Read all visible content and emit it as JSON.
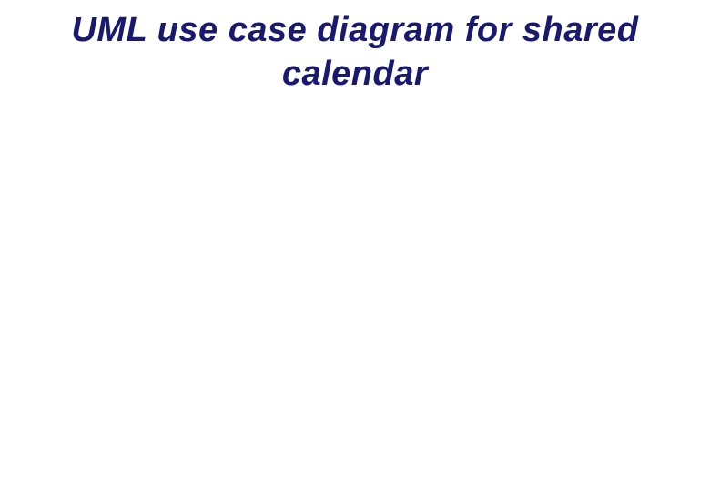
{
  "slide": {
    "title": "UML use case diagram for shared calendar"
  }
}
